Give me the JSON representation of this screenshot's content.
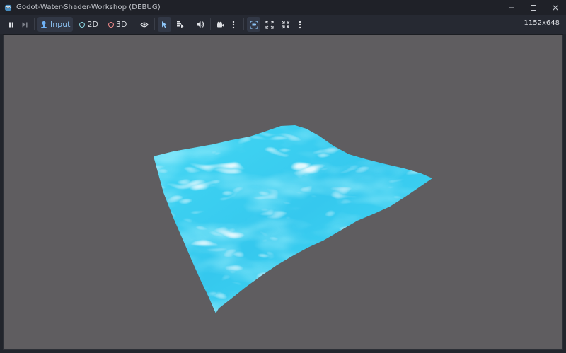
{
  "window": {
    "title": "Godot-Water-Shader-Workshop (DEBUG)",
    "icon": "godot-icon",
    "controls": [
      "minimize-icon",
      "maximize-icon",
      "close-icon"
    ]
  },
  "toolbar": {
    "pause_icon": "pause-icon",
    "next_frame_icon": "step-frame-icon",
    "input_label": "Input",
    "mode_2d_label": "2D",
    "mode_3d_label": "3D",
    "visibility_icon": "eye-icon",
    "select_icon": "select-arrow-icon",
    "list_icon": "list-select-icon",
    "audio_icon": "speaker-icon",
    "camera_icon": "camera-icon",
    "more_icon": "vertical-dots-icon",
    "camera_override_icon": "camera-override-icon",
    "fit_icon": "expand-icon",
    "fullscreen_icon": "fullscreen-icon",
    "resolution": "1152x648"
  },
  "colors": {
    "accent": "#6fb1f5",
    "mode_2d": "#8ad8e3",
    "mode_3d": "#f08a8a",
    "viewport_bg": "#5f5d60",
    "water": "#3fd5f2"
  }
}
